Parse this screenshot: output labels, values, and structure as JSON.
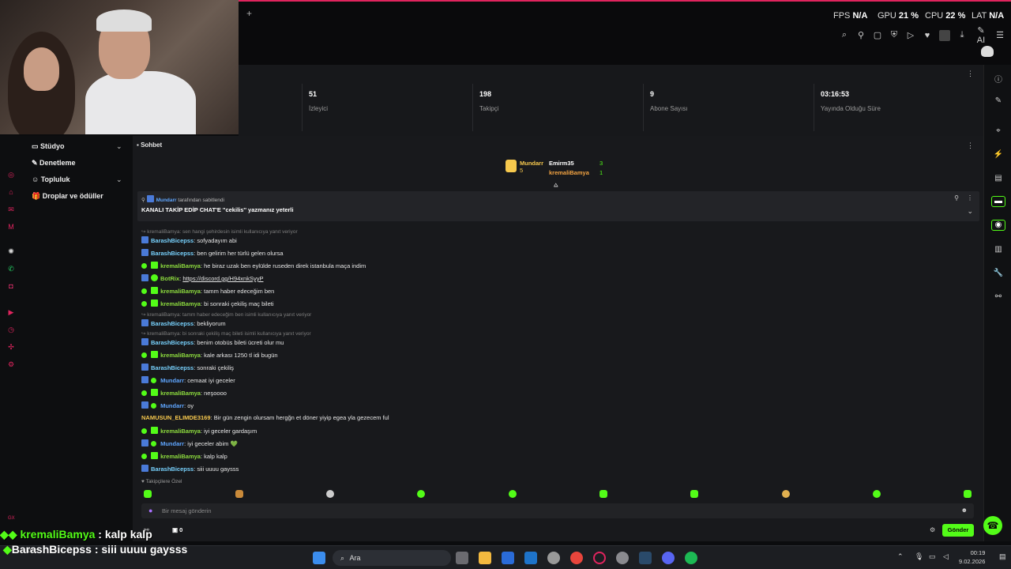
{
  "topbar": {
    "plus": "+",
    "fps_label": "FPS",
    "fps_value": "N/A",
    "gpu_label": "GPU",
    "gpu_value": "21 %",
    "cpu_label": "CPU",
    "cpu_value": "22 %",
    "lat_label": "LAT",
    "lat_value": "N/A",
    "ai_label": "AI"
  },
  "stats": [
    {
      "value": "51",
      "label": "İzleyici"
    },
    {
      "value": "198",
      "label": "Takipçi"
    },
    {
      "value": "9",
      "label": "Abone Sayısı"
    },
    {
      "value": "03:16:53",
      "label": "Yayında Olduğu Süre"
    }
  ],
  "nav": {
    "studio": "Stüdyo",
    "moderation": "Denetleme",
    "community": "Topluluk",
    "drops": "Droplar ve ödüller"
  },
  "chat": {
    "title": "Sohbet",
    "leaderboard": {
      "first_name": "Mundarr",
      "first_count": "5",
      "second_name": "Emirm35",
      "second_count": "3",
      "third_name": "kremaliBamya",
      "third_count": "1"
    },
    "pinned": {
      "by_user": "Mundarr",
      "by_suffix": "tarafından sabitlendi",
      "text": "KANALI TAKİP EDİP CHAT'E ''cekilis'' yazmanız yeterli"
    },
    "messages": [
      {
        "reply": "kremaliBamya: sen hangi şehirdesin isimli kullanıcıya yanıt veriyor"
      },
      {
        "user": "BarashBicepss",
        "text": ": sofyadayım abi",
        "cls": "u-cyan"
      },
      {
        "user": "BarashBicepss",
        "text": ": ben gelirim her türlü gelen olursa",
        "cls": "u-cyan"
      },
      {
        "user": "kremaliBamya",
        "text": ": he biraz uzak ben eylülde ruseden direk istanbula maça indim",
        "cls": "u-lime"
      },
      {
        "user": "BotRix",
        "text": ": ",
        "link": "https://discord.gg/H94xnkSyyP",
        "cls": "u-lime"
      },
      {
        "user": "kremaliBamya",
        "text": ": tamm haber edeceğim ben",
        "cls": "u-lime"
      },
      {
        "user": "kremaliBamya",
        "text": ": bi sonraki çekiliş maç bileti",
        "cls": "u-lime"
      },
      {
        "reply": "kremaliBamya: tamm haber edeceğim ben isimli kullanıcıya yanıt veriyor"
      },
      {
        "user": "BarashBicepss",
        "text": ": bekliyorum",
        "cls": "u-cyan"
      },
      {
        "reply": "kremaliBamya: bi sonraki çekiliş maç bileti isimli kullanıcıya yanıt veriyor"
      },
      {
        "user": "BarashBicepss",
        "text": ": benim otobüs bileti ücreti olur mu",
        "cls": "u-cyan"
      },
      {
        "user": "kremaliBamya",
        "text": ": kale arkası 1250 tl idi bugün",
        "cls": "u-lime"
      },
      {
        "user": "BarashBicepss",
        "text": ": sonraki çekiliş",
        "cls": "u-cyan"
      },
      {
        "user": "Mundarr",
        "text": ": cemaat iyi geceler",
        "cls": "u-blue"
      },
      {
        "user": "kremaliBamya",
        "text": ": neşoooo",
        "cls": "u-lime"
      },
      {
        "user": "Mundarr",
        "text": ": oy",
        "cls": "u-blue"
      },
      {
        "user": "NAMUSUN_ELIMDE3169",
        "text": ": Bir gün zengin olursam hergğn et döner yiyip egea yla gezecem ful",
        "cls": "u-yellow"
      },
      {
        "user": "kremaliBamya",
        "text": ": iyi geceler gardaşım",
        "cls": "u-lime"
      },
      {
        "user": "Mundarr",
        "text": ": iyi geceler abim 💚",
        "cls": "u-blue"
      },
      {
        "user": "kremaliBamya",
        "text": ": kalp kalp",
        "cls": "u-lime"
      },
      {
        "user": "BarashBicepss",
        "text": ": siii uuuu gaysss",
        "cls": "u-cyan"
      }
    ],
    "followers_only": "Takipçilere Özel",
    "input_placeholder": "Bir mesaj gönderin",
    "send_label": "Gönder",
    "pts": "0"
  },
  "overlay": {
    "line1_user": "kremaliBamya",
    "line1_text": ": kalp kalp",
    "line2_user": "BarashBicepss",
    "line2_text": ": siii uuuu gaysss",
    "temp": "11°C"
  },
  "taskbar": {
    "search_label": "Ara",
    "time": "00:19",
    "date": "9.02.2026"
  }
}
